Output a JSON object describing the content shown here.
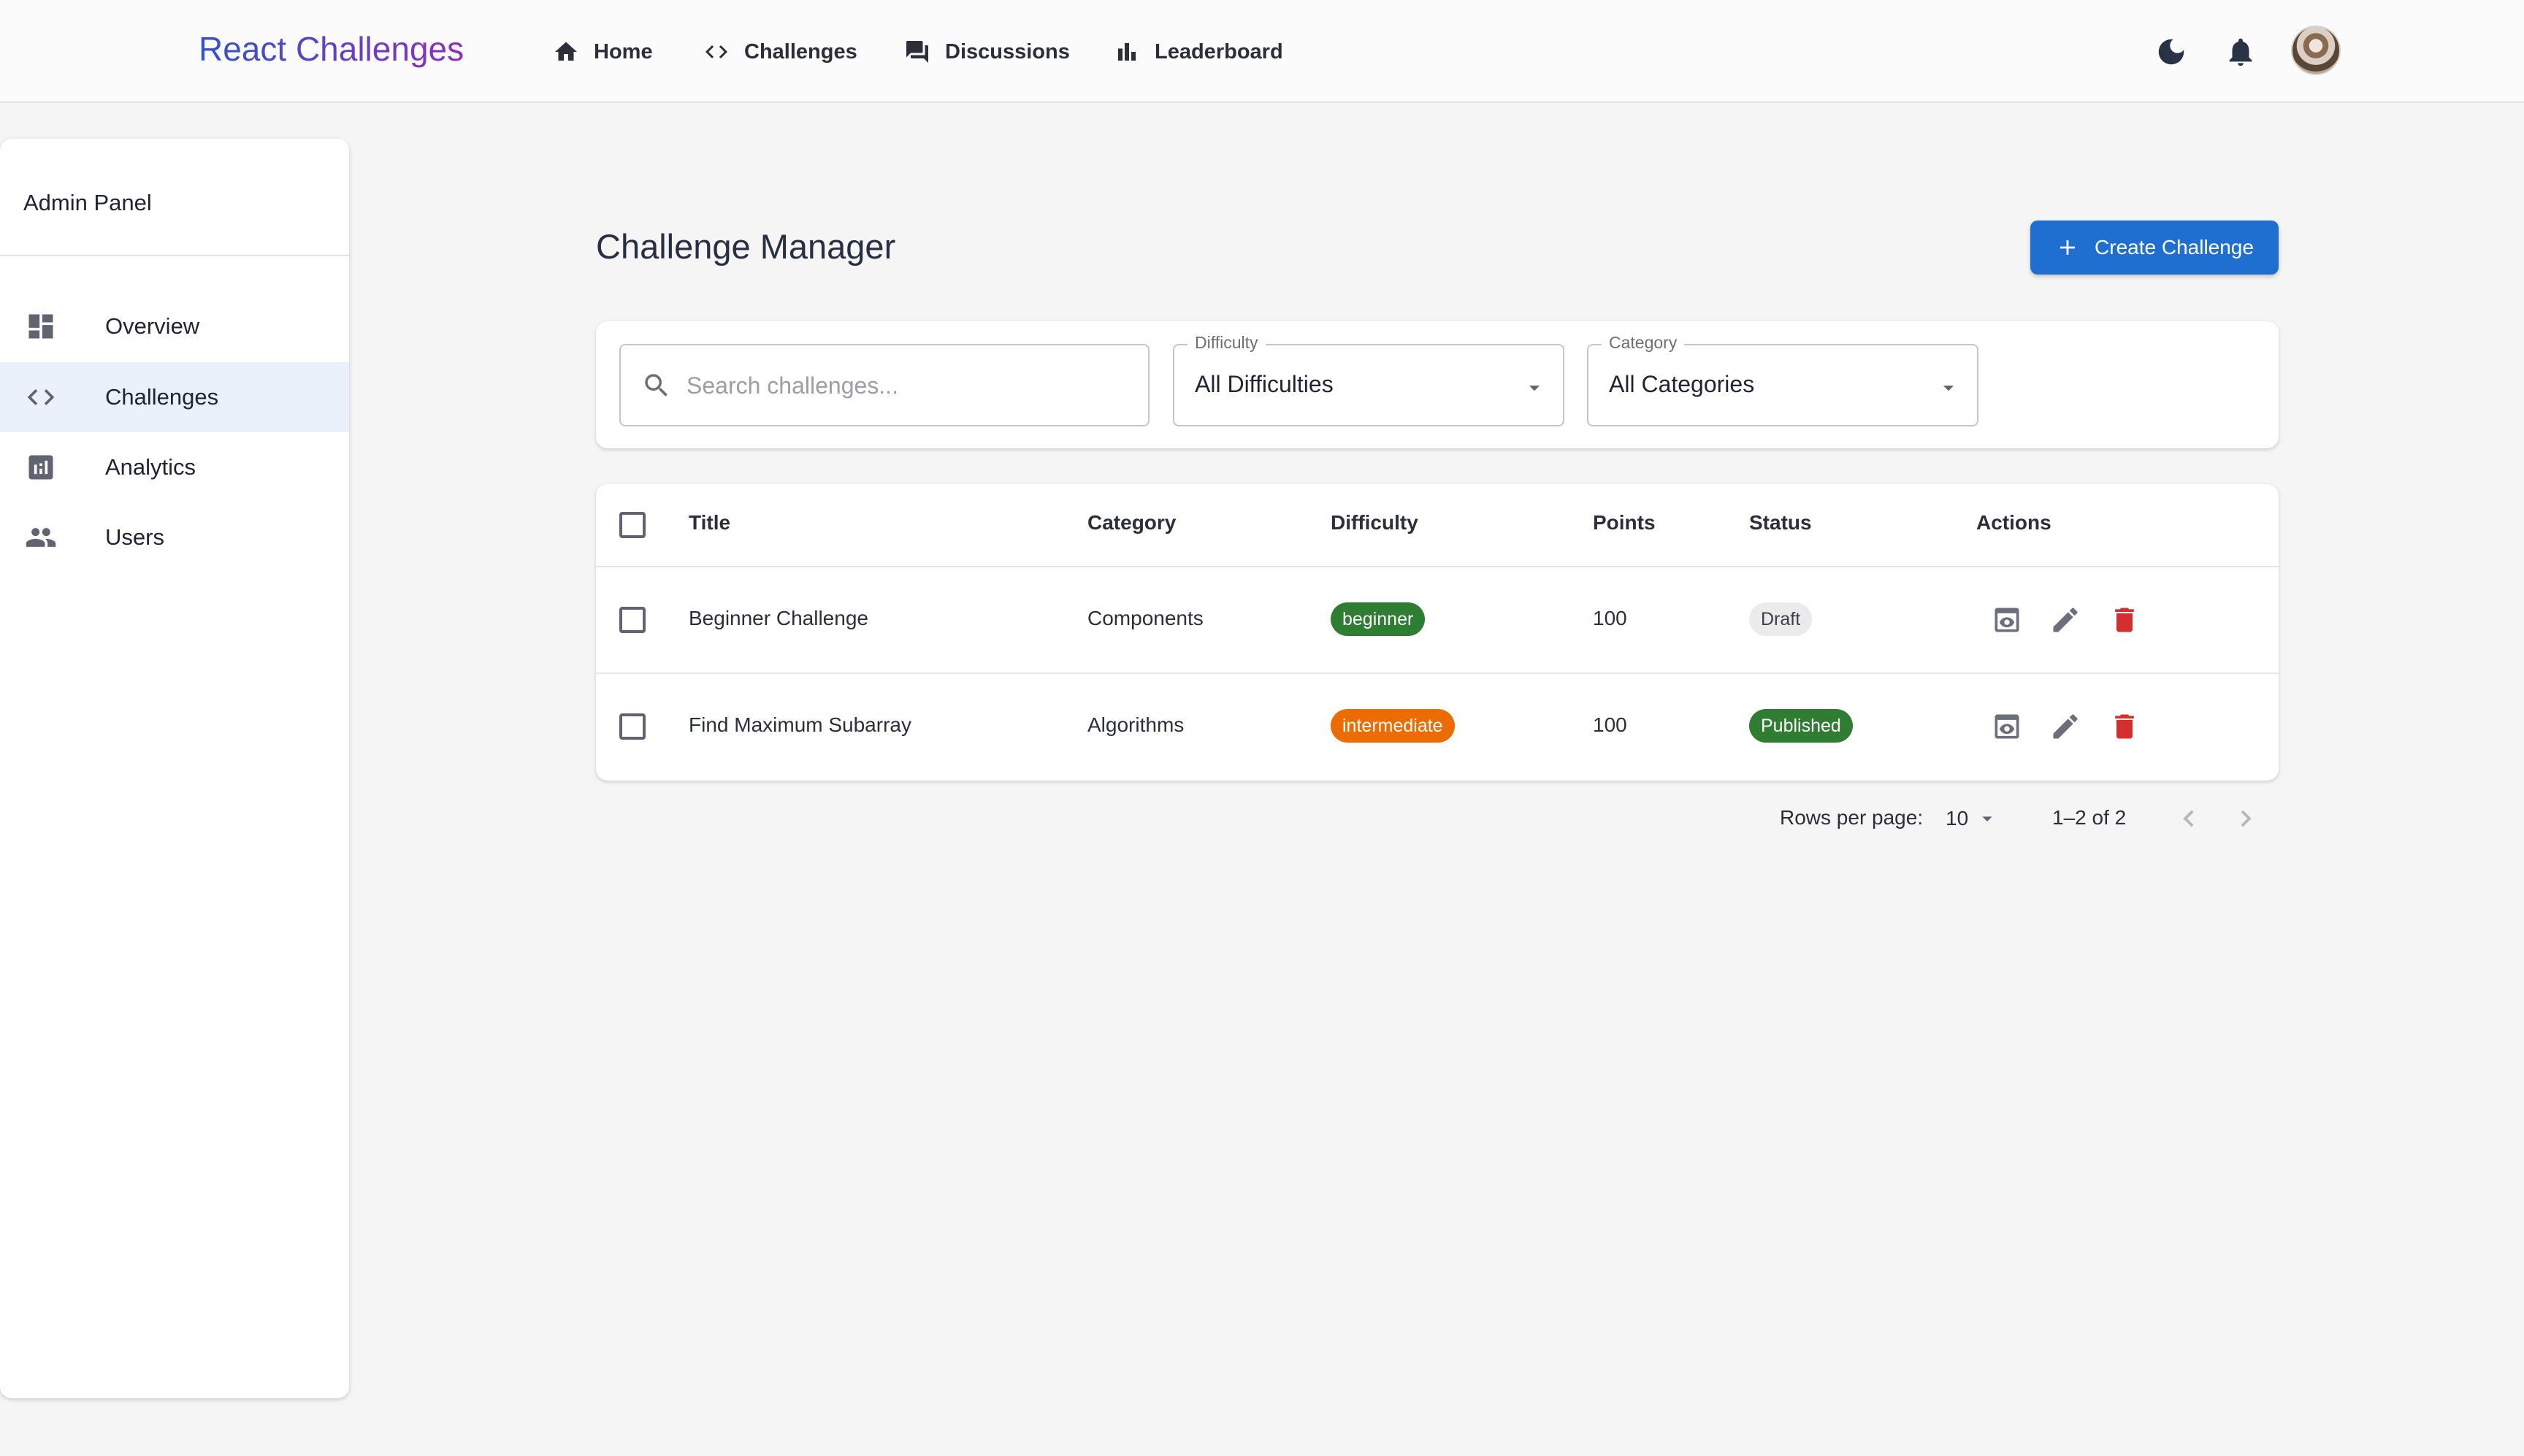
{
  "app": {
    "brand": "React Challenges"
  },
  "nav": {
    "items": [
      {
        "label": "Home",
        "icon": "home-icon"
      },
      {
        "label": "Challenges",
        "icon": "code-icon"
      },
      {
        "label": "Discussions",
        "icon": "forum-icon"
      },
      {
        "label": "Leaderboard",
        "icon": "leaderboard-icon"
      }
    ],
    "right_icons": [
      "moon-icon",
      "bell-icon",
      "avatar"
    ]
  },
  "sidebar": {
    "title": "Admin Panel",
    "items": [
      {
        "label": "Overview",
        "icon": "dashboard-icon",
        "active": false
      },
      {
        "label": "Challenges",
        "icon": "code-icon",
        "active": true
      },
      {
        "label": "Analytics",
        "icon": "analytics-icon",
        "active": false
      },
      {
        "label": "Users",
        "icon": "people-icon",
        "active": false
      }
    ]
  },
  "main": {
    "title": "Challenge Manager",
    "create_button": "Create Challenge",
    "filters": {
      "search_placeholder": "Search challenges...",
      "search_value": "",
      "difficulty_label": "Difficulty",
      "difficulty_value": "All Difficulties",
      "category_label": "Category",
      "category_value": "All Categories"
    },
    "table": {
      "columns": [
        "Title",
        "Category",
        "Difficulty",
        "Points",
        "Status",
        "Actions"
      ],
      "rows": [
        {
          "title": "Beginner Challenge",
          "category": "Components",
          "difficulty": "beginner",
          "points": "100",
          "status": "Draft"
        },
        {
          "title": "Find Maximum Subarray",
          "category": "Algorithms",
          "difficulty": "intermediate",
          "points": "100",
          "status": "Published"
        }
      ],
      "action_icons": [
        "preview-icon",
        "edit-icon",
        "delete-icon"
      ]
    },
    "pagination": {
      "rows_per_page_label": "Rows per page:",
      "rows_per_page_value": "10",
      "range": "1–2 of 2"
    }
  },
  "colors": {
    "primary": "#1f6fd1",
    "beginner": "#2e7d32",
    "intermediate": "#ed6c02",
    "published": "#2e7d32",
    "draft": "#ebebeb",
    "delete": "#d32f2f"
  }
}
